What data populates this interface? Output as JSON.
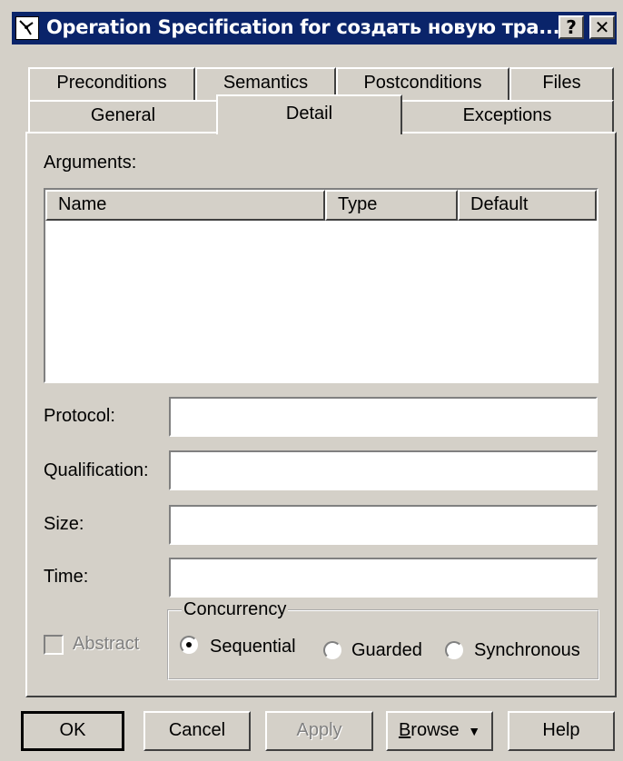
{
  "window": {
    "title": "Operation Specification for создать новую тра...",
    "help_label": "?",
    "close_label": "✕"
  },
  "tabs": {
    "row1": [
      "Preconditions",
      "Semantics",
      "Postconditions",
      "Files"
    ],
    "row2": [
      "General",
      "Detail",
      "Exceptions"
    ],
    "active": "Detail"
  },
  "arguments": {
    "label": "Arguments:",
    "columns": [
      "Name",
      "Type",
      "Default"
    ],
    "rows": []
  },
  "fields": {
    "protocol": {
      "label": "Protocol:",
      "value": ""
    },
    "qualification": {
      "label": "Qualification:",
      "value": ""
    },
    "size": {
      "label": "Size:",
      "value": ""
    },
    "time": {
      "label": "Time:",
      "value": ""
    }
  },
  "abstract": {
    "label": "Abstract",
    "checked": false,
    "enabled": false
  },
  "concurrency": {
    "label": "Concurrency",
    "options": [
      "Sequential",
      "Guarded",
      "Synchronous"
    ],
    "selected": "Sequential"
  },
  "buttons": {
    "ok": "OK",
    "cancel": "Cancel",
    "apply": "Apply",
    "browse_prefix": "B",
    "browse_rest": "rowse",
    "browse_arrow": "▼",
    "help": "Help"
  }
}
